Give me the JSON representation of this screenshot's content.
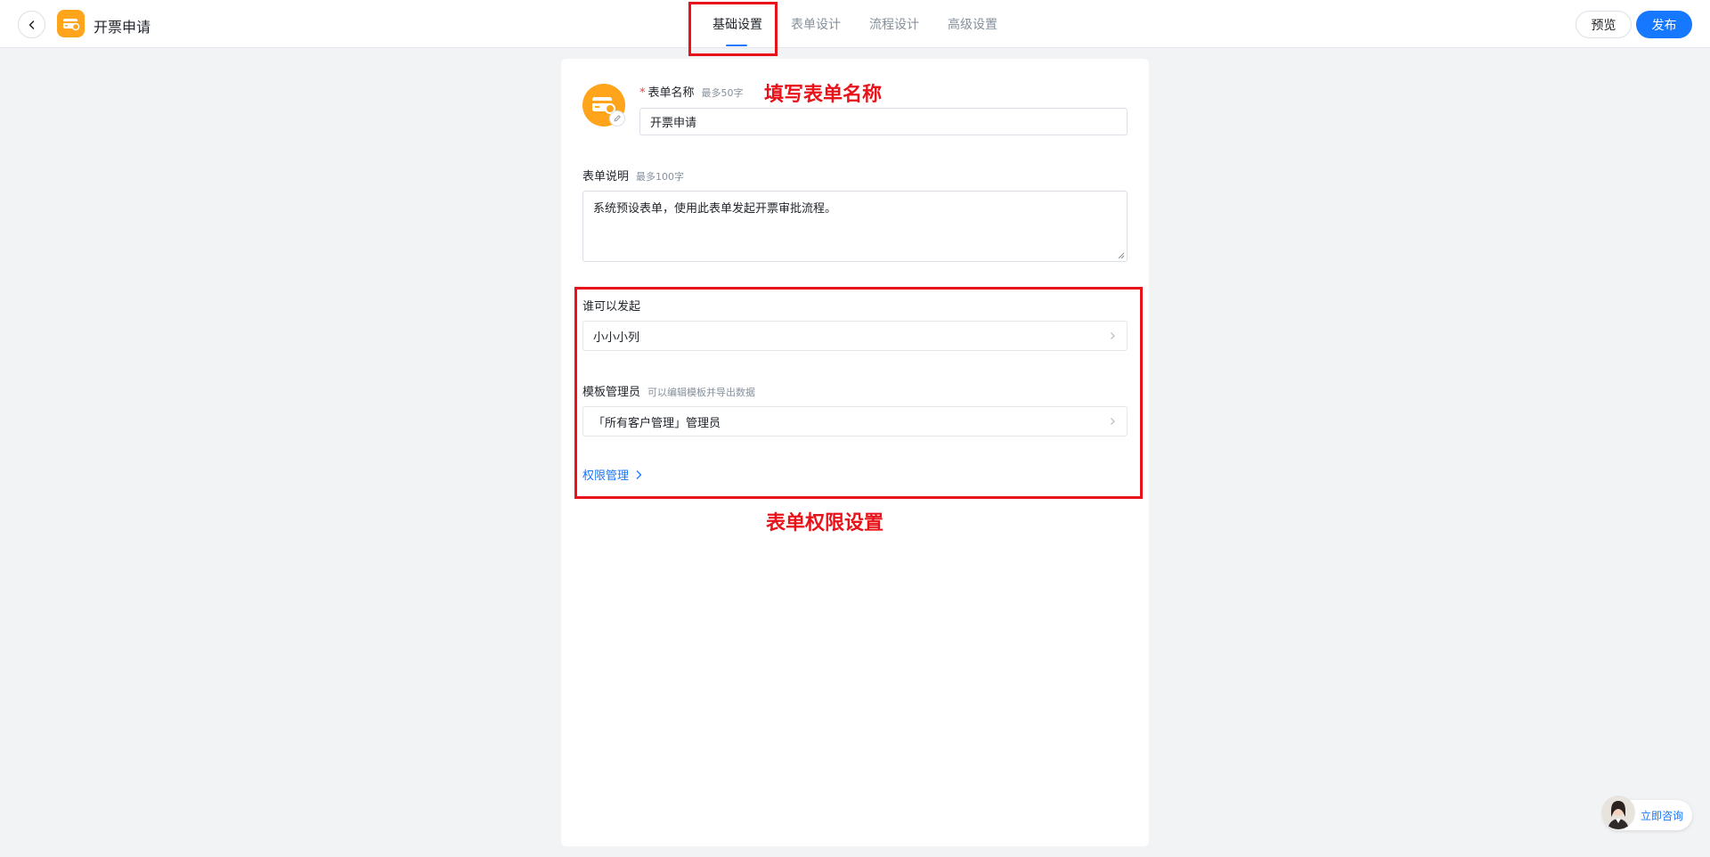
{
  "header": {
    "app_title": "开票申请",
    "tabs": [
      {
        "label": "基础设置",
        "active": true
      },
      {
        "label": "表单设计",
        "active": false
      },
      {
        "label": "流程设计",
        "active": false
      },
      {
        "label": "高级设置",
        "active": false
      }
    ],
    "preview_label": "预览",
    "publish_label": "发布"
  },
  "form": {
    "name": {
      "required_mark": "*",
      "label": "表单名称",
      "hint": "最多50字",
      "value": "开票申请"
    },
    "description": {
      "label": "表单说明",
      "hint": "最多100字",
      "value": "系统预设表单，使用此表单发起开票审批流程。"
    },
    "initiators": {
      "label": "谁可以发起",
      "value": "小小小列"
    },
    "admins": {
      "label": "模板管理员",
      "hint": "可以编辑模板并导出数据",
      "value": "「所有客户管理」管理员"
    },
    "permission_link": "权限管理"
  },
  "annotations": {
    "name_note": "填写表单名称",
    "permission_note": "表单权限设置",
    "color": "#e8131a"
  },
  "consult": {
    "label": "立即咨询"
  },
  "colors": {
    "accent": "#1677ff",
    "app_icon": "#ffa41b"
  }
}
